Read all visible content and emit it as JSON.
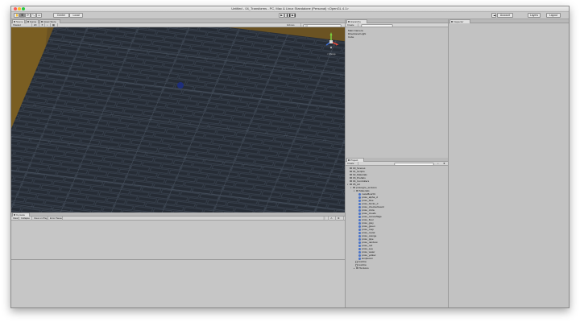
{
  "window": {
    "title": "Untitled - 04_Transforms - PC, Mac & Linux Standalone (Personal) <OpenGL 4.1>"
  },
  "toolbar": {
    "pivot_label": "Center",
    "space_label": "Local",
    "collab_label": "Account",
    "layers_label": "Layers",
    "layout_label": "Layout"
  },
  "scene": {
    "tab_label": "Scene",
    "game_tab_label": "Game",
    "asset_store_tab_label": "Asset Store",
    "shading_mode": "Shaded",
    "mode_2d": "2D",
    "gizmos_label": "Gizmos",
    "search_placeholder": "All",
    "persp_label": "< Persp"
  },
  "hierarchy": {
    "tab_label": "Hierarchy",
    "create_label": "Create",
    "items": [
      "Main Camera",
      "Directional Light",
      "Cube"
    ]
  },
  "inspector": {
    "tab_label": "Inspector"
  },
  "console": {
    "tab_label": "Console",
    "buttons": [
      "Clear",
      "Collapse",
      "Clear on Play",
      "Error Pause"
    ]
  },
  "project": {
    "tab_label": "Project",
    "create_label": "Create",
    "folders": [
      "00_Scenes",
      "01_Scripts",
      "02_Materials",
      "03_Prefabs",
      "04_Controllers",
      "05_Art"
    ],
    "art_children": [
      "prototype_textures"
    ],
    "materials_folder": "Materials",
    "materials": [
      "metalfloor01",
      "proto_alpha_d",
      "proto_blue",
      "proto_bricks_d",
      "proto_checkerboard",
      "proto_circle",
      "proto_clouds",
      "proto_camouflage",
      "proto_floor",
      "proto_gray",
      "proto_green",
      "proto_map",
      "proto_metal",
      "proto_orange",
      "proto_pipe",
      "proto_rainbow",
      "proto_red",
      "proto_sea",
      "proto_water",
      "proto_yellow",
      "simplecon"
    ],
    "files": [
      "readme",
      "readme"
    ],
    "textures_folder": "Textures"
  }
}
